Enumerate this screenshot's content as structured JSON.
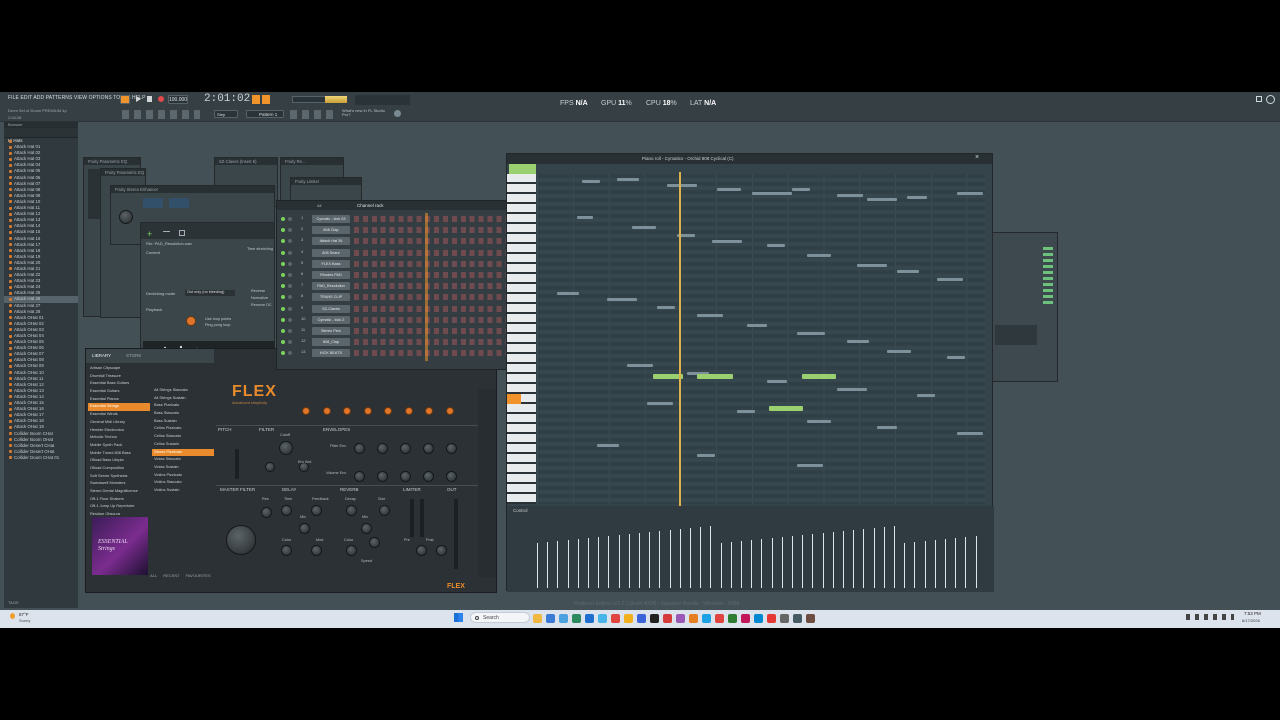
{
  "menu": {
    "items": "FILE  EDIT  ADD  PATTERNS  VIEW  OPTIONS  TOOLS  HELP"
  },
  "transport": {
    "time": "2:01:02",
    "tempo": "100.000",
    "pattern": "Pattern 1",
    "mode": "Step",
    "hint_line1": "Drum Set of Doom  PREMIUM 4p",
    "hint_line2": "What's new in FL Studio Pro?",
    "project": "2:04:28"
  },
  "perf": {
    "fps_label": "FPS",
    "fps": "N/A",
    "gpu_label": "GPU",
    "gpu": "11",
    "cpu_label": "CPU",
    "cpu": "18",
    "lat_label": "LAT",
    "lat": "N/A",
    "unit": "%"
  },
  "browser": {
    "header": "Browser",
    "folder": "Hi Hats",
    "items": [
      "Attack Hat 01",
      "Attack Hat 02",
      "Attack Hat 03",
      "Attack Hat 04",
      "Attack Hat 05",
      "Attack Hat 06",
      "Attack Hat 07",
      "Attack Hat 08",
      "Attack Hat 09",
      "Attack Hat 10",
      "Attack Hat 11",
      "Attack Hat 12",
      "Attack Hat 13",
      "Attack Hat 14",
      "Attack Hat 15",
      "Attack Hat 16",
      "Attack Hat 17",
      "Attack Hat 18",
      "Attack Hat 19",
      "Attack Hat 20",
      "Attack Hat 21",
      "Attack Hat 22",
      "Attack Hat 23",
      "Attack Hat 24",
      "Attack Hat 25",
      "Attack Hat 26",
      "Attack Hat 27",
      "Attack Hat 28",
      "Attack OHat 01",
      "Attack OHat 02",
      "Attack OHat 03",
      "Attack OHat 04",
      "Attack OHat 05",
      "Attack OHat 06",
      "Attack OHat 07",
      "Attack OHat 08",
      "Attack OHat 09",
      "Attack OHat 10",
      "Attack OHat 11",
      "Attack OHat 12",
      "Attack OHat 13",
      "Attack OHat 14",
      "Attack OHat 15",
      "Attack OHat 16",
      "Attack OHat 17",
      "Attack OHat 18",
      "Attack OHat 19",
      "Collider Boom CHat",
      "Collider Boom OHat",
      "Collider Desert CHat",
      "Collider Desert OHat",
      "Collider Doom CHat 01"
    ],
    "selected_index": 25,
    "footer": "TAGS"
  },
  "channel_rack": {
    "title": "Channel rack",
    "filter": "All",
    "rows": [
      {
        "num": "1",
        "name": "Cymatic - kick 03"
      },
      {
        "num": "2",
        "name": "808 Clap"
      },
      {
        "num": "3",
        "name": "Attack Hat 26"
      },
      {
        "num": "4",
        "name": "808 Snare"
      },
      {
        "num": "5",
        "name": "FLEX Bass"
      },
      {
        "num": "6",
        "name": "Rhodes PAD"
      },
      {
        "num": "7",
        "name": "PAD_Resolution"
      },
      {
        "num": "8",
        "name": "TRANS CLIP"
      },
      {
        "num": "9",
        "name": "SZ-Claves"
      },
      {
        "num": "10",
        "name": "Cymatic - kick 2"
      },
      {
        "num": "11",
        "name": "Stereo Perc"
      },
      {
        "num": "12",
        "name": "808_Clap"
      },
      {
        "num": "13",
        "name": "KICK BEATS"
      }
    ]
  },
  "piano_roll": {
    "title": "Piano roll - Cymatics - Orchid 808 Cyclical (C)",
    "control": "Control"
  },
  "plugin_windows": {
    "fp1": "Fruity Parametric EQ",
    "fp2": "Fruity Parametric EQ",
    "fs": "Fruity Stereo Enhancer",
    "sz": "SZ-Claves (Insert 6)",
    "frz": "Fruity Re...",
    "lim": "Fruity Limiter",
    "sampler": {
      "file": "File: PAD_Resolution.wav",
      "content": "Content",
      "declicking": "Declicking mode",
      "declick_value": "Out only (no bleeding)",
      "playback": "Playback",
      "useloop": "Use loop points",
      "pingpong": "Ping pong loop",
      "time_stretch": "Time stretching",
      "reverse": "Reverse",
      "normalize": "Normalize",
      "remove_dc": "Remove DC"
    }
  },
  "flex": {
    "logo": "FLEX",
    "subtitle": "Advanced simplicity",
    "library_tab": "LIBRARY",
    "store_tab": "STORE",
    "packs": [
      "Artisan Cityscape",
      "Drumfall Treasure",
      "Essential Bass Guitars",
      "Essential Guitars",
      "Essential Pianos",
      "Essential Strings",
      "Essential Winds",
      "General Midi Library",
      "Hemble Electronica",
      "Melodic Techno",
      "Mobile Synth Pack",
      "Mobile Tuned 808 Bass",
      "Ofload Bass Utopia",
      "Ofload Composition",
      "Soft Server Synthesis",
      "Swanswell Monsters",
      "Stereo Dental Magnificence",
      "Off-1 Floor Shakers",
      "Off-1 Jump Up Repertoire",
      "Residue Obscura"
    ],
    "selected_pack": 5,
    "presets": [
      "All Strings Staccato",
      "All Strings Sustain",
      "Bass Pizzicato",
      "Bass Staccato",
      "Bass Sustain",
      "Cellos Pizzicato",
      "Cellos Staccato",
      "Cellos Sustain",
      "Sforzo Pizzicato",
      "Violas Staccato",
      "Violas Sustain",
      "Violins Pizzicato",
      "Violins Staccato",
      "Violins Sustain"
    ],
    "selected_preset": 8,
    "sections": {
      "pitch": "PITCH",
      "filter": "FILTER",
      "envelopes": "ENVELOPES",
      "master_filter": "MASTER FILTER",
      "delay": "DELAY",
      "reverb": "REVERB",
      "limiter": "LIMITER",
      "out": "OUT"
    },
    "knobs": {
      "cutoff": "Cutoff",
      "res": "Res",
      "env_amt": "Env Amt",
      "filter_env": "Filter Env",
      "volume_env": "Volume Env",
      "time": "Time",
      "feedback": "Feedback",
      "mix": "Mix",
      "decay": "Decay",
      "size": "Size",
      "color": "Color",
      "mod": "Mod",
      "speed": "Speed",
      "pre": "Pre",
      "post": "Post"
    },
    "pack_name": "ESSENTIAL Strings",
    "footer_tabs": [
      "ALL",
      "RECENT",
      "FAVOURITES"
    ]
  },
  "status": {
    "footer": "Producer Edition v21.2.3 [build 4004] - Signature Bundle - Windows - 64Bit"
  },
  "taskbar": {
    "search": "Search",
    "weather": "87°F",
    "weather_desc": "Sunny",
    "time": "7:53 PM",
    "date": "6/17/2026"
  }
}
